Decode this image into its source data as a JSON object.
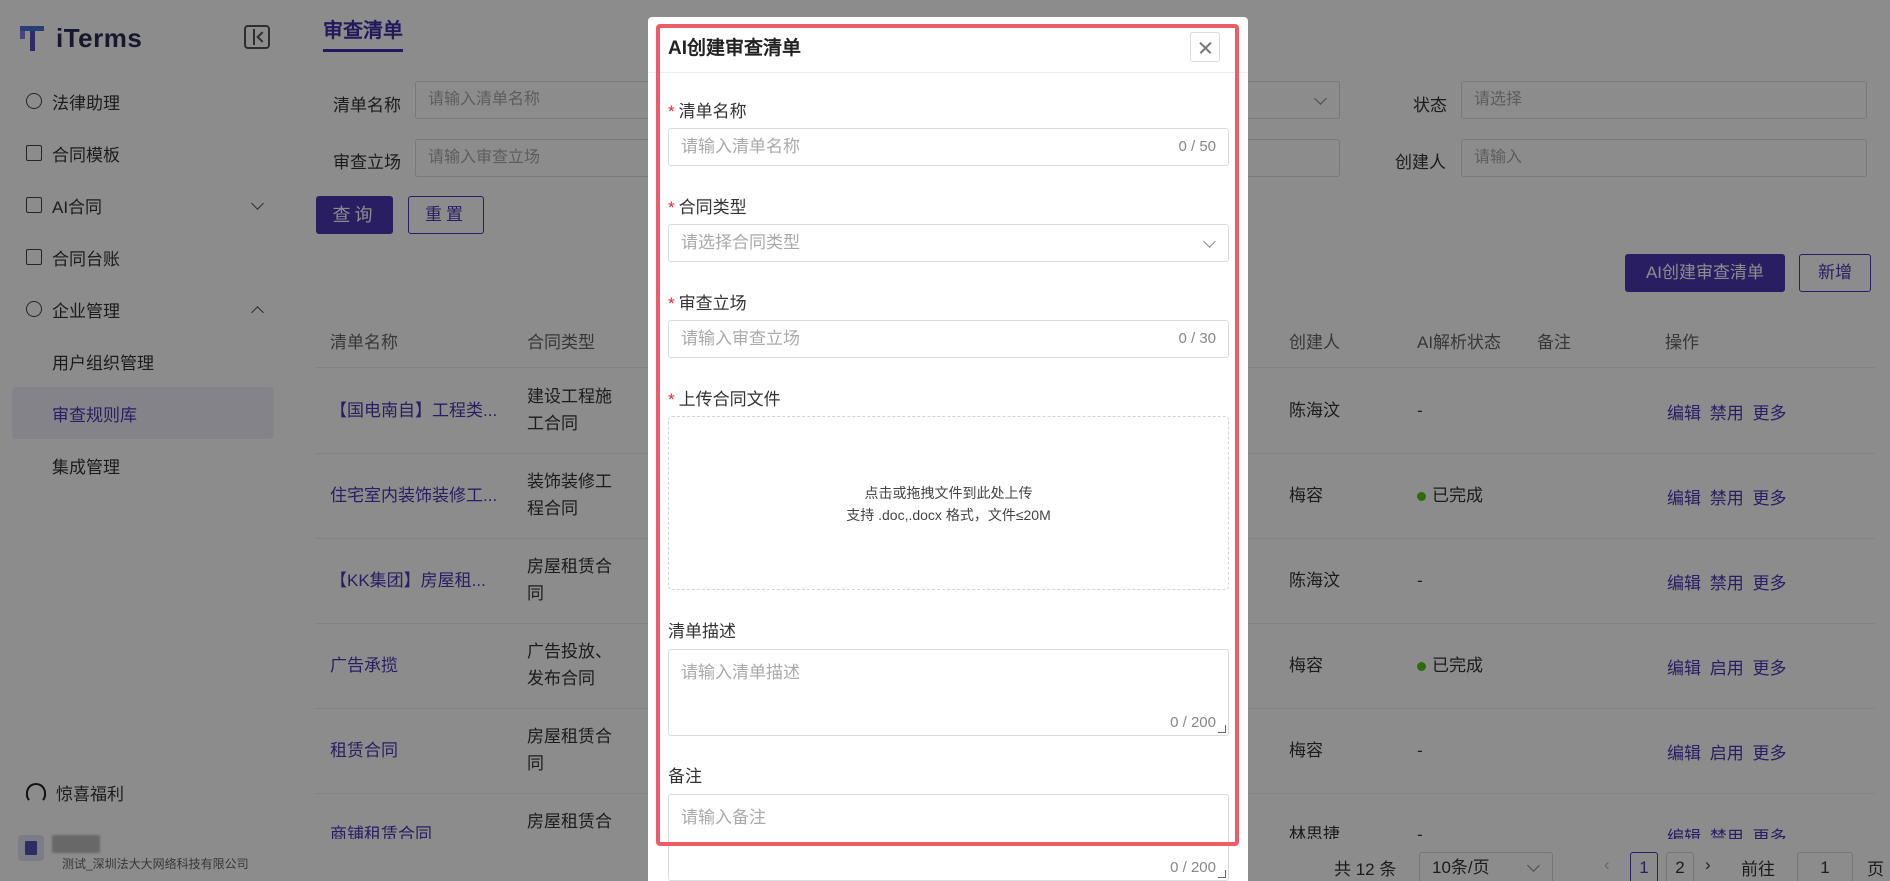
{
  "brand": {
    "name": "iTerms"
  },
  "sidebar": {
    "items": [
      {
        "label": "法律助理"
      },
      {
        "label": "合同模板"
      },
      {
        "label": "AI合同"
      },
      {
        "label": "合同台账"
      },
      {
        "label": "企业管理"
      }
    ],
    "sub_items": [
      {
        "label": "用户组织管理"
      },
      {
        "label": "审查规则库"
      },
      {
        "label": "集成管理"
      }
    ],
    "bottom_link": "惊喜福利",
    "org_name": "测试_深圳法大大网络科技有限公司"
  },
  "page": {
    "tab": "审查清单"
  },
  "filters": {
    "name_label": "清单名称",
    "name_placeholder": "请输入清单名称",
    "stance_label": "审查立场",
    "stance_placeholder": "请输入审查立场",
    "status_label": "状态",
    "status_placeholder": "请选择",
    "creator_label": "创建人",
    "creator_placeholder": "请输入",
    "query_button": "查询",
    "reset_button": "重置"
  },
  "toolbar": {
    "ai_create": "AI创建审查清单",
    "add": "新增"
  },
  "table": {
    "headers": [
      "清单名称",
      "合同类型",
      "创建人",
      "AI解析状态",
      "备注",
      "操作"
    ],
    "rows": [
      {
        "name": "【国电南自】工程类...",
        "type_line1": "建设工程施",
        "type_line2": "工合同",
        "creator": "陈海汶",
        "status": "-",
        "ops": "编辑 禁用 更多"
      },
      {
        "name": "住宅室内装饰装修工...",
        "type_line1": "装饰装修工",
        "type_line2": "程合同",
        "creator": "梅容",
        "status": "已完成",
        "ops": "编辑 禁用 更多"
      },
      {
        "name": "【KK集团】房屋租...",
        "type_line1": "房屋租赁合",
        "type_line2": "同",
        "creator": "陈海汶",
        "status": "-",
        "ops": "编辑 禁用 更多"
      },
      {
        "name": "广告承揽",
        "type_line1": "广告投放、",
        "type_line2": "发布合同",
        "creator": "梅容",
        "status": "已完成",
        "ops": "编辑 启用 更多"
      },
      {
        "name": "租赁合同",
        "type_line1": "房屋租赁合",
        "type_line2": "同",
        "creator": "梅容",
        "status": "-",
        "ops": "编辑 启用 更多"
      },
      {
        "name": "商铺租赁合同",
        "type_line1": "房屋租赁合",
        "type_line2": "",
        "creator": "林思捷",
        "status": "-",
        "ops": "编辑 禁用 更多"
      }
    ]
  },
  "pagination": {
    "total": "共 12 条",
    "page_size": "10条/页",
    "page1": "1",
    "page2": "2",
    "goto_label": "前往",
    "goto_value": "1",
    "page_suffix": "页"
  },
  "modal": {
    "title": "AI创建审查清单",
    "name_label": "清单名称",
    "name_placeholder": "请输入清单名称",
    "name_count": "0 / 50",
    "type_label": "合同类型",
    "type_placeholder": "请选择合同类型",
    "stance_label": "审查立场",
    "stance_placeholder": "请输入审查立场",
    "stance_count": "0 / 30",
    "upload_label": "上传合同文件",
    "upload_hint1": "点击或拖拽文件到此处上传",
    "upload_hint2": "支持 .doc,.docx 格式，文件≤20M",
    "desc_label": "清单描述",
    "desc_placeholder": "请输入清单描述",
    "desc_count": "0 / 200",
    "remark_label": "备注",
    "remark_placeholder": "请输入备注",
    "remark_count": "0 / 200"
  },
  "colors": {
    "brand": "#4b38b3",
    "highlight": "#ef5b67",
    "success": "#52c41a",
    "required": "#f5222d"
  }
}
